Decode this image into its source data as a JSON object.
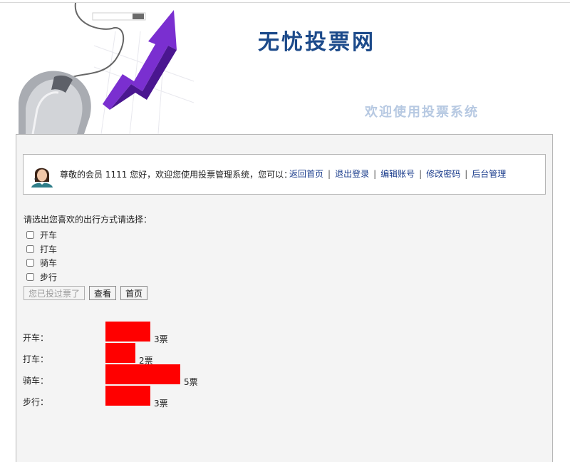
{
  "header": {
    "title": "无忧投票网",
    "slogan": "欢迎使用投票系统",
    "banner_icons": [
      "computer-mouse",
      "rising-arrow"
    ]
  },
  "userbar": {
    "avatar_icon": "user-avatar",
    "welcome": "尊敬的会员  1111  您好，欢迎您使用投票管理系统，您可以：",
    "links": [
      "返回首页",
      "退出登录",
      "编辑账号",
      "修改密码",
      "后台管理"
    ],
    "separator": "|",
    "link_color": "#1a3c8c"
  },
  "vote": {
    "prompt": "请选出您喜欢的出行方式请选择：",
    "options": [
      "开车",
      "打车",
      "骑车",
      "步行"
    ],
    "buttons": {
      "voted": "您已投过票了",
      "view": "查看",
      "home": "首页"
    }
  },
  "results": {
    "bar_color": "#ff0000",
    "rows": [
      {
        "label": "开车：",
        "votes": 3,
        "count_text": "3票"
      },
      {
        "label": "打车：",
        "votes": 2,
        "count_text": "2票"
      },
      {
        "label": "骑车：",
        "votes": 5,
        "count_text": "5票"
      },
      {
        "label": "步行：",
        "votes": 3,
        "count_text": "3票"
      }
    ]
  }
}
